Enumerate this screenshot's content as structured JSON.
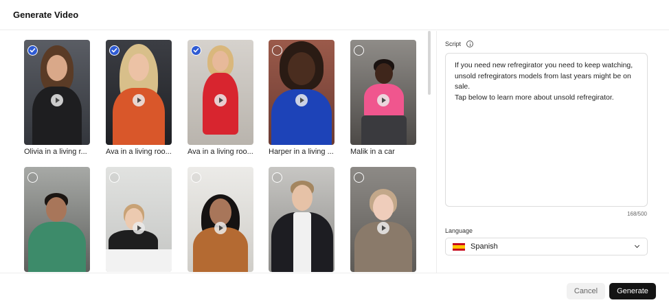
{
  "dialog": {
    "title": "Generate Video"
  },
  "avatars": [
    {
      "label": "Olivia in a living r...",
      "selected": true
    },
    {
      "label": "Ava in a living roo...",
      "selected": true
    },
    {
      "label": "Ava in a living roo...",
      "selected": true
    },
    {
      "label": "Harper in a living ...",
      "selected": false
    },
    {
      "label": "Malik in a car",
      "selected": false
    },
    {
      "label": "",
      "selected": false
    },
    {
      "label": "",
      "selected": false
    },
    {
      "label": "",
      "selected": false
    },
    {
      "label": "",
      "selected": false
    },
    {
      "label": "",
      "selected": false
    }
  ],
  "script": {
    "label": "Script",
    "text": "If you need new refregirator you need to keep watching, unsold refregirators models from last years might be on sale.\nTap below to learn more about unsold refregirator.",
    "counter": "168/500"
  },
  "language": {
    "label": "Language",
    "selected": "Spanish",
    "flag_icon": "spain-flag-icon"
  },
  "footer": {
    "cancel_label": "Cancel",
    "generate_label": "Generate"
  },
  "colors": {
    "accent": "#2f5bd3",
    "primary_button": "#141414"
  }
}
